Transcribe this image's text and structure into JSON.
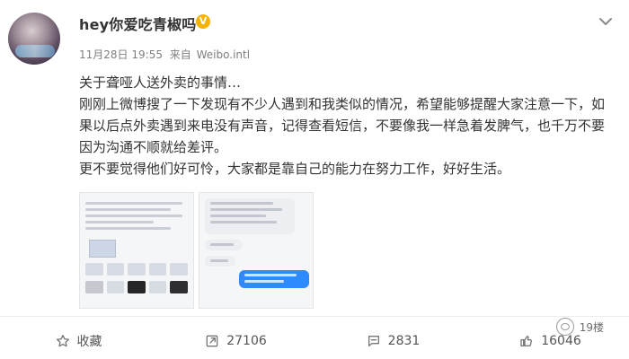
{
  "post": {
    "username": "hey你爱吃青椒吗",
    "verified_badge": "V",
    "date": "11月28日",
    "time": "19:55",
    "source_prefix": "来自",
    "source": "Weibo.intl",
    "text_lines": [
      "关于聋哑人送外卖的事情…",
      "刚刚上微博搜了一下发现有不少人遇到和我类似的情况，希望能够提醒大家注意一下，如果以后点外卖遇到来电没有声音，记得查看短信，不要像我一样急着发脾气，也千万不要因为沟通不顺就给差评。",
      "更不要觉得他们好可怜，大家都是靠自己的能力在努力工作，好好生活。"
    ]
  },
  "images": {
    "thumb1": {
      "chat_lines": [
        "您，是快递员来了。",
        "请您按照地址发送，确认送达，",
        "外卖员，我耳朵听不见也不会说话"
      ]
    },
    "thumb2": {
      "chat_lines": [
        "您好，我是聋人，外卖到了",
        "您好，我是聋人，请您在门口拿一下",
        "好的，谢谢"
      ]
    }
  },
  "actions": {
    "favorite": {
      "label": "收藏",
      "icon": "star-icon"
    },
    "repost": {
      "count": "27106",
      "icon": "repost-icon"
    },
    "comment": {
      "count": "2831",
      "icon": "comment-icon"
    },
    "like": {
      "count": "16046",
      "icon": "thumbs-up-icon"
    }
  },
  "watermark": "19楼",
  "colors": {
    "badge": "#f6b200",
    "text": "#333333",
    "meta": "#808080",
    "bubble_blue": "#2e8bff"
  }
}
